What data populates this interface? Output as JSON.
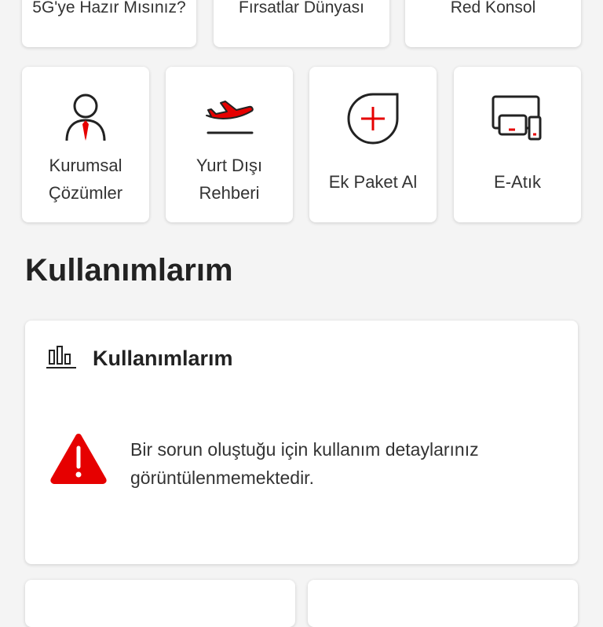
{
  "top_cards": [
    {
      "label": "5G'ye Hazır Mısınız?"
    },
    {
      "label": "Fırsatlar Dünyası"
    },
    {
      "label": "Red Konsol"
    }
  ],
  "tiles": [
    {
      "label": "Kurumsal\nÇözümler",
      "icon": "business-person-icon"
    },
    {
      "label": "Yurt Dışı\nRehberi",
      "icon": "airplane-icon"
    },
    {
      "label": "Ek Paket Al",
      "icon": "add-package-icon"
    },
    {
      "label": "E-Atık",
      "icon": "e-waste-devices-icon"
    }
  ],
  "section_title": "Kullanımlarım",
  "usage_card": {
    "title": "Kullanımlarım",
    "icon": "bar-chart-icon",
    "error_icon": "warning-icon",
    "error_message": "Bir sorun oluştuğu için kullanım detaylarınız\ngörüntülenmemektedir."
  },
  "colors": {
    "accent": "#e60000",
    "text": "#222222",
    "background": "#f4f4f4"
  }
}
